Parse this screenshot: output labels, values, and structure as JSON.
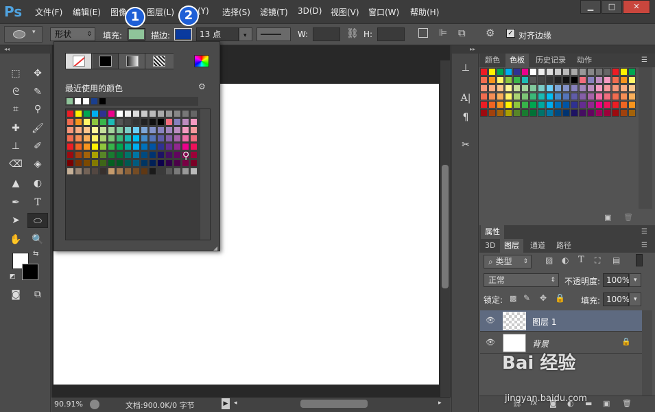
{
  "app": {
    "logo": "Ps"
  },
  "menu": [
    "文件(F)",
    "编辑(E)",
    "图像",
    "图层(L)",
    "(Y)",
    "选择(S)",
    "滤镜(T)",
    "3D(D)",
    "视图(V)",
    "窗口(W)",
    "帮助(H)"
  ],
  "window_buttons": {
    "minimize": "▁",
    "maximize": "□",
    "close": "✕"
  },
  "options": {
    "mode": "形状",
    "fill_label": "填充:",
    "stroke_label": "描边:",
    "stroke_size": "13 点",
    "w_label": "W:",
    "h_label": "H:",
    "align_edges": "对齐边缘",
    "fill_color": "#8fc49a",
    "stroke_color": "#0a3a9e"
  },
  "badges": [
    "1",
    "2"
  ],
  "popup": {
    "recent_label": "最近使用的颜色",
    "recent_colors": [
      "#8fc49a",
      "#ffffff",
      "#ffffff",
      "#1a3f8f",
      "#000000"
    ]
  },
  "panels": {
    "top_tabs": [
      "颜色",
      "色板",
      "历史记录",
      "动作"
    ],
    "top_active": "色板",
    "properties_tab": "属性",
    "layer_tabs": [
      "3D",
      "图层",
      "通道",
      "路径"
    ],
    "layer_active": "图层",
    "filter_kind": "类型",
    "blend_mode": "正常",
    "opacity_label": "不透明度:",
    "opacity_value": "100%",
    "lock_label": "锁定:",
    "fill_label": "填充:",
    "fill_value": "100%"
  },
  "layers": [
    {
      "name": "图层 1",
      "selected": true
    },
    {
      "name": "背景",
      "selected": false
    }
  ],
  "status": {
    "zoom": "90.91%",
    "doc": "文档:900.0K/0 字节"
  },
  "watermark": {
    "text": "Bai 经验",
    "url": "jingyan.baidu.com"
  }
}
